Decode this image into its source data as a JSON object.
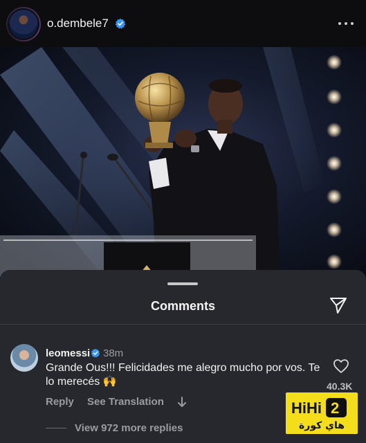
{
  "post": {
    "username": "o.dembele7",
    "verified": true
  },
  "comments_sheet": {
    "title": "Comments"
  },
  "comment": {
    "username": "leomessi",
    "time": "38m",
    "text": "Grande Ous!!! Felicidades me alegro mucho por vos. Te lo merecés 🙌",
    "reply_label": "Reply",
    "translate_label": "See Translation",
    "likes": "40.3K",
    "view_replies": "View 972 more replies"
  },
  "watermark": {
    "latin": "HiHi2",
    "arabic": "هاي كورة"
  },
  "colors": {
    "background": "#0b0b0d",
    "sheet": "#26282d",
    "verified_blue": "#3897f0",
    "muted_text": "#9a9ca3",
    "watermark_yellow": "#f4dd1b"
  },
  "icons": [
    "more-options-icon",
    "verified-icon",
    "send-icon",
    "heart-icon",
    "arrow-down-icon"
  ]
}
